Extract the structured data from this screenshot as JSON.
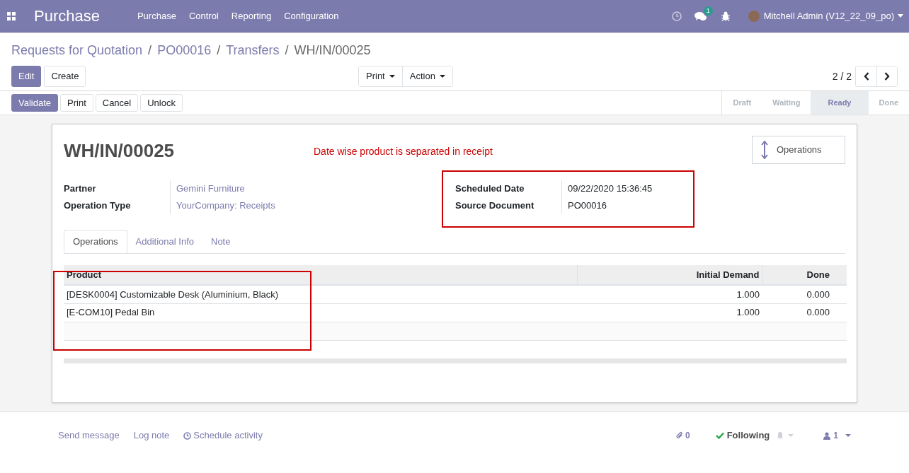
{
  "navbar": {
    "app_title": "Purchase",
    "menu": [
      "Purchase",
      "Control",
      "Reporting",
      "Configuration"
    ],
    "message_count": "1",
    "user": "Mitchell Admin (V12_22_09_po)"
  },
  "breadcrumbs": [
    {
      "kind": "link",
      "label": "Requests for Quotation"
    },
    {
      "kind": "separator",
      "label": "/"
    },
    {
      "kind": "link",
      "label": "PO00016"
    },
    {
      "kind": "separator",
      "label": "/"
    },
    {
      "kind": "link",
      "label": "Transfers"
    },
    {
      "kind": "separator",
      "label": "/"
    },
    {
      "kind": "current",
      "label": "WH/IN/00025"
    }
  ],
  "control_buttons": [
    {
      "label": "Edit",
      "primary": true
    },
    {
      "label": "Create",
      "primary": false
    }
  ],
  "sidebar_buttons": [
    "Print",
    "Action"
  ],
  "pager": "2 / 2",
  "header_buttons": [
    {
      "label": "Validate",
      "primary": true
    },
    {
      "label": "Print",
      "primary": false
    },
    {
      "label": "Cancel",
      "primary": false
    },
    {
      "label": "Unlock",
      "primary": false
    }
  ],
  "stages": [
    {
      "label": "Draft",
      "selected": false
    },
    {
      "label": "Waiting",
      "selected": false
    },
    {
      "label": "Ready",
      "selected": true
    },
    {
      "label": "Done",
      "selected": false
    }
  ],
  "form": {
    "title": "WH/IN/00025",
    "note": "Date wise product is separated in receipt",
    "smart_button": "Operations",
    "left_fields": [
      {
        "label": "Partner",
        "value": "Gemini Furniture",
        "link": true
      },
      {
        "label": "Operation Type",
        "value": "YourCompany: Receipts",
        "link": true
      }
    ],
    "right_fields": [
      {
        "label": "Scheduled Date",
        "value": "09/22/2020 15:36:45",
        "link": false
      },
      {
        "label": "Source Document",
        "value": "PO00016",
        "link": false
      }
    ],
    "right_fields_highlighted": true,
    "tabs": [
      {
        "label": "Operations",
        "selected": true
      },
      {
        "label": "Additional Info",
        "selected": false
      },
      {
        "label": "Note",
        "selected": false
      }
    ],
    "table": {
      "columns": [
        "Product",
        "Initial Demand",
        "Done"
      ],
      "product_highlighted": true,
      "rows": [
        [
          "[DESK0004] Customizable Desk (Aluminium, Black)",
          "1.000",
          "0.000"
        ],
        [
          "[E-COM10] Pedal Bin",
          "1.000",
          "0.000"
        ]
      ]
    }
  },
  "chatter": {
    "actions": [
      "Send message",
      "Log note",
      "Schedule activity"
    ],
    "attachments": "0",
    "follow": "Following",
    "followers": "1"
  }
}
